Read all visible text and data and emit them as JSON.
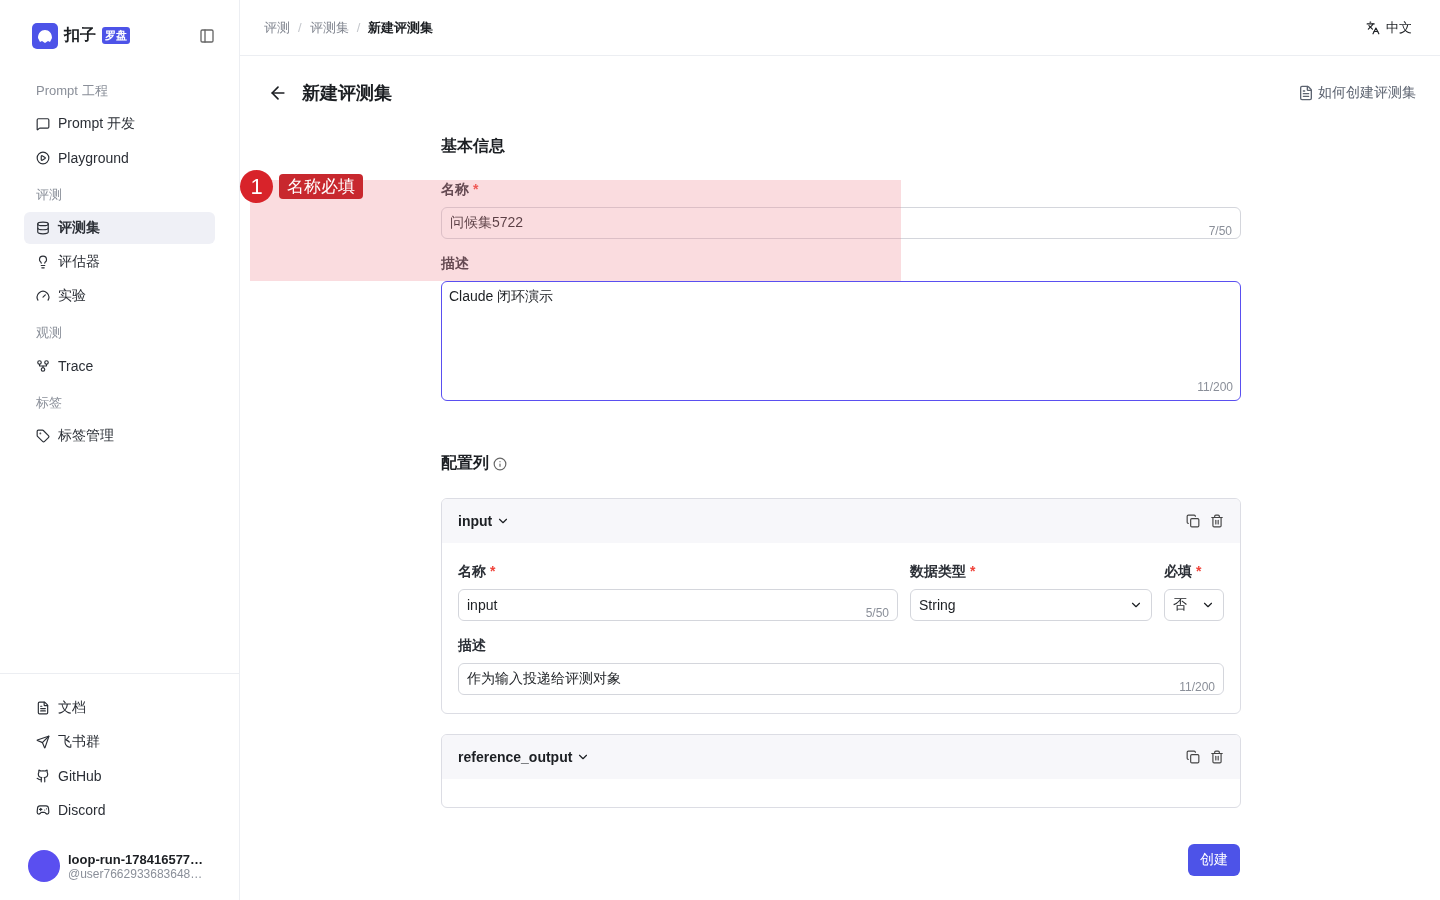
{
  "sidebar": {
    "brand": {
      "name": "扣子",
      "badge": "罗盘"
    },
    "groups": [
      {
        "title": "Prompt 工程",
        "items": [
          {
            "label": "Prompt 开发",
            "selected": false
          },
          {
            "label": "Playground",
            "selected": false
          }
        ]
      },
      {
        "title": "评测",
        "items": [
          {
            "label": "评测集",
            "selected": true
          },
          {
            "label": "评估器",
            "selected": false
          },
          {
            "label": "实验",
            "selected": false
          }
        ]
      },
      {
        "title": "观测",
        "items": [
          {
            "label": "Trace",
            "selected": false
          }
        ]
      },
      {
        "title": "标签",
        "items": [
          {
            "label": "标签管理",
            "selected": false
          }
        ]
      }
    ],
    "footer_links": [
      {
        "label": "文档"
      },
      {
        "label": "飞书群"
      },
      {
        "label": "GitHub"
      },
      {
        "label": "Discord"
      }
    ],
    "user": {
      "name": "loop-run-178416577…",
      "handle": "@user7662933683648…"
    }
  },
  "breadcrumb": [
    {
      "label": "评测",
      "selected": false
    },
    {
      "label": "评测集",
      "selected": false
    },
    {
      "label": "新建评测集",
      "selected": true
    }
  ],
  "breadcrumb_separator": "/",
  "language": "中文",
  "page": {
    "title": "新建评测集",
    "help_link": "如何创建评测集"
  },
  "basic_info": {
    "heading": "基本信息",
    "name": {
      "label": "名称",
      "required_mark": "*",
      "value": "问候集5722",
      "counter": "7/50"
    },
    "description": {
      "label": "描述",
      "value": "Claude 闭环演示",
      "counter": "11/200",
      "focused": true
    }
  },
  "columns_section": {
    "heading": "配置列",
    "columns": [
      {
        "title": "input",
        "name_label": "名称",
        "name_value": "input",
        "name_counter": "5/50",
        "type_label": "数据类型",
        "type_value": "String",
        "required_label": "必填",
        "required_value": "否",
        "desc_label": "描述",
        "desc_value": "作为输入投递给评测对象",
        "desc_counter": "11/200",
        "required_mark": "*",
        "expanded": true
      },
      {
        "title": "reference_output",
        "expanded": true
      }
    ]
  },
  "annotation": {
    "number": "1",
    "text": "名称必填"
  },
  "submit": "创建"
}
